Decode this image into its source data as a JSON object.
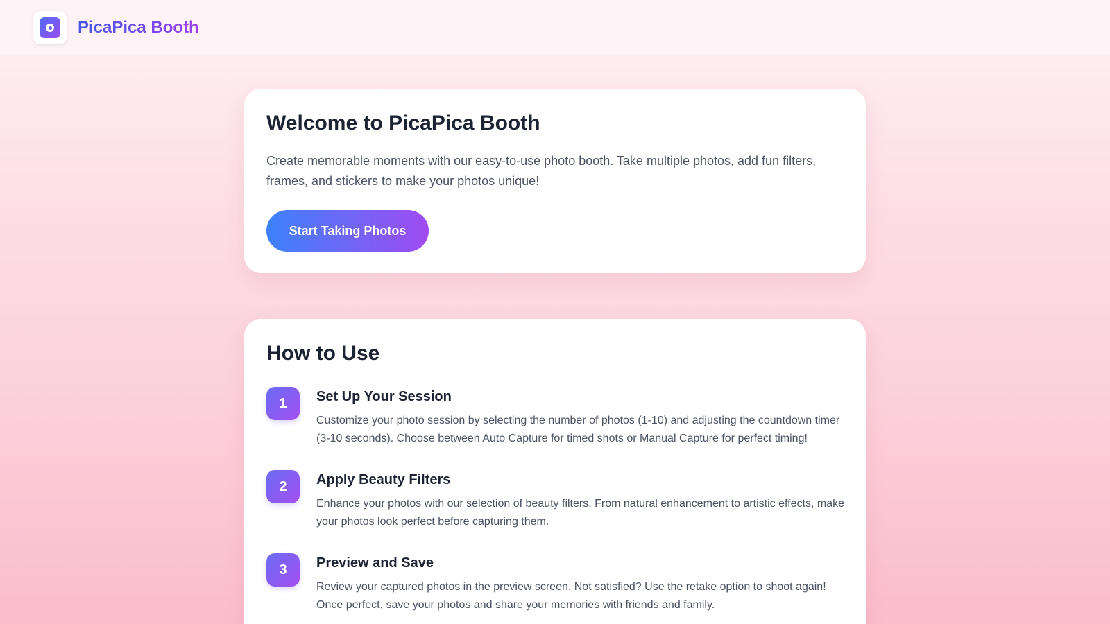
{
  "header": {
    "app_title": "PicaPica Booth",
    "logo_icon": "camera-lens-icon"
  },
  "welcome": {
    "title": "Welcome to PicaPica Booth",
    "description": "Create memorable moments with our easy-to-use photo booth. Take multiple photos, add fun filters, frames, and stickers to make your photos unique!",
    "button_label": "Start Taking Photos"
  },
  "how_to_use": {
    "title": "How to Use",
    "steps": [
      {
        "number": "1",
        "title": "Set Up Your Session",
        "description": "Customize your photo session by selecting the number of photos (1-10) and adjusting the countdown timer (3-10 seconds). Choose between Auto Capture for timed shots or Manual Capture for perfect timing!"
      },
      {
        "number": "2",
        "title": "Apply Beauty Filters",
        "description": "Enhance your photos with our selection of beauty filters. From natural enhancement to artistic effects, make your photos look perfect before capturing them."
      },
      {
        "number": "3",
        "title": "Preview and Save",
        "description": "Review your captured photos in the preview screen. Not satisfied? Use the retake option to shoot again! Once perfect, save your photos and share your memories with friends and family."
      }
    ]
  },
  "colors": {
    "accent_start": "#3d82fa",
    "accent_end": "#a04bf2",
    "heading": "#1c2333",
    "body_text": "#4a5262"
  }
}
